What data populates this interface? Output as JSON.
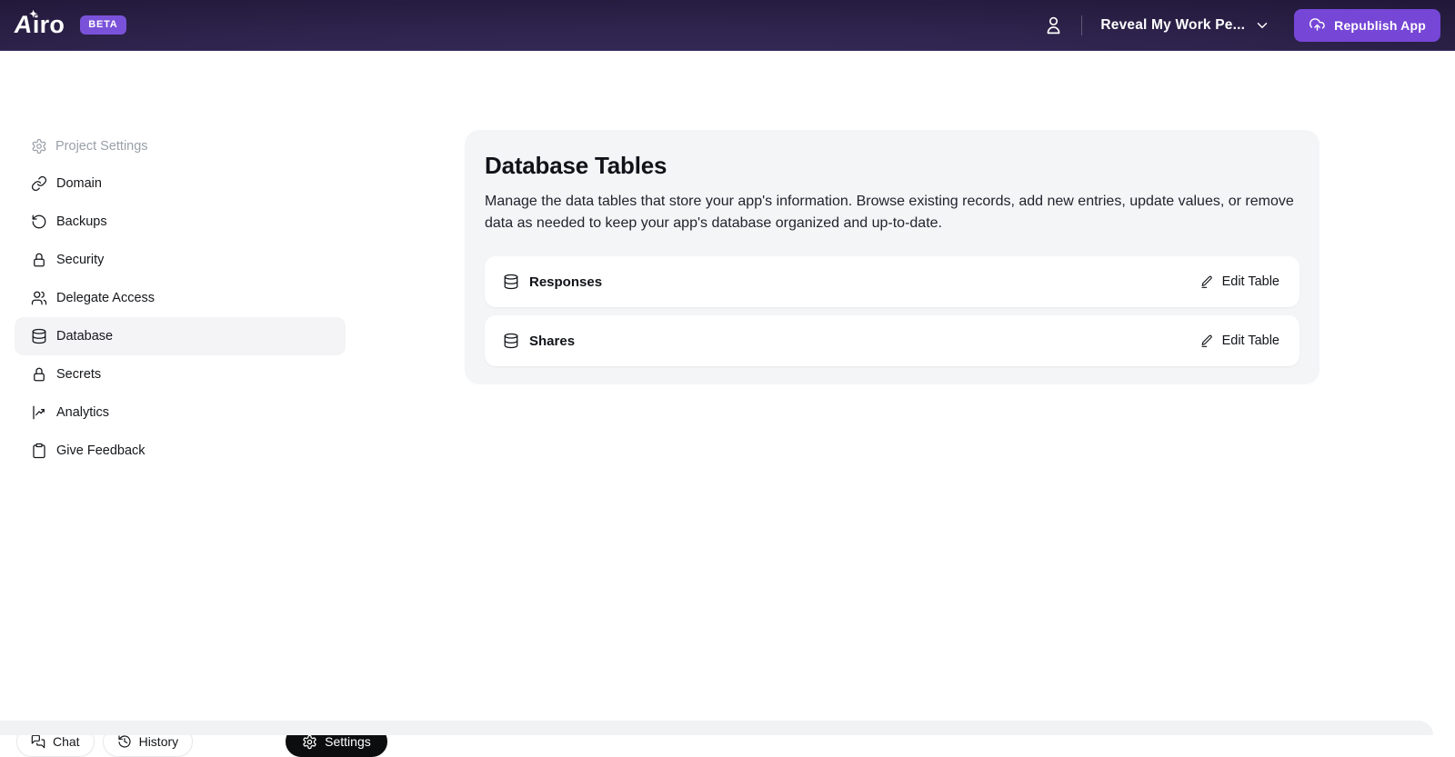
{
  "nav": {
    "logo": "Airo",
    "beta_badge": "BETA",
    "app_title": "Reveal My Work Pe...",
    "republish_label": "Republish App"
  },
  "sidebar": {
    "header": {
      "label": "Project Settings"
    },
    "items": [
      {
        "label": "Domain",
        "icon": "link-icon"
      },
      {
        "label": "Backups",
        "icon": "rotate-ccw-icon"
      },
      {
        "label": "Security",
        "icon": "lock-icon"
      },
      {
        "label": "Delegate Access",
        "icon": "users-icon"
      },
      {
        "label": "Database",
        "icon": "database-icon",
        "selected": true
      },
      {
        "label": "Secrets",
        "icon": "lock-icon"
      },
      {
        "label": "Analytics",
        "icon": "chart-line-icon"
      },
      {
        "label": "Give Feedback",
        "icon": "clipboard-icon"
      }
    ]
  },
  "main": {
    "title": "Database Tables",
    "description": "Manage the data tables that store your app's information. Browse existing records, add new entries, update values, or remove data as needed to keep your app's database organized and up-to-date.",
    "tables": [
      {
        "name": "Responses",
        "icon": "database-icon",
        "action_label": "Edit Table"
      },
      {
        "name": "Shares",
        "icon": "database-icon",
        "action_label": "Edit Table"
      }
    ]
  },
  "toolbar": {
    "chat_label": "Chat",
    "history_label": "History",
    "settings_label": "Settings"
  },
  "colors": {
    "accent_purple": "#7646D6",
    "beta_badge_purple": "#7A52D9",
    "nav_bg_dark": "#150D27",
    "nav_bg_light": "#352B5A",
    "panel_bg": "#F4F5F7",
    "selected_item_bg": "#F4F4F6",
    "settings_pill_bg": "#0C0D0E",
    "muted_text": "#9AA0A9"
  }
}
